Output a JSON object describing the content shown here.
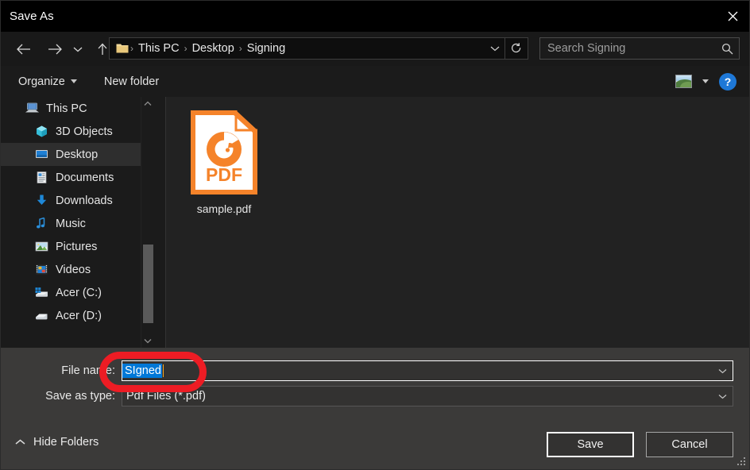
{
  "window": {
    "title": "Save As",
    "close_icon": "close-icon"
  },
  "nav": {
    "back_icon": "arrow-left-icon",
    "forward_icon": "arrow-right-icon",
    "history_icon": "chevron-down-icon",
    "up_icon": "arrow-up-icon",
    "address": {
      "folder_icon": "folder-icon",
      "separator": "›",
      "crumbs": [
        "This PC",
        "Desktop",
        "Signing"
      ],
      "dropdown_icon": "chevron-down-icon",
      "refresh_icon": "refresh-icon"
    },
    "search": {
      "placeholder": "Search Signing",
      "value": "",
      "icon": "search-icon"
    }
  },
  "command_bar": {
    "organize_label": "Organize",
    "new_folder_label": "New folder",
    "view_icon": "picture-view-icon",
    "view_dropdown_icon": "chevron-down-icon",
    "help_label": "?",
    "help_icon": "help-icon"
  },
  "sidebar": {
    "items": [
      {
        "label": "This PC",
        "icon": "this-pc-icon",
        "selected": false,
        "indent": false
      },
      {
        "label": "3D Objects",
        "icon": "3d-objects-icon",
        "selected": false,
        "indent": true
      },
      {
        "label": "Desktop",
        "icon": "desktop-icon",
        "selected": true,
        "indent": true
      },
      {
        "label": "Documents",
        "icon": "documents-icon",
        "selected": false,
        "indent": true
      },
      {
        "label": "Downloads",
        "icon": "downloads-icon",
        "selected": false,
        "indent": true
      },
      {
        "label": "Music",
        "icon": "music-icon",
        "selected": false,
        "indent": true
      },
      {
        "label": "Pictures",
        "icon": "pictures-icon",
        "selected": false,
        "indent": true
      },
      {
        "label": "Videos",
        "icon": "videos-icon",
        "selected": false,
        "indent": true
      },
      {
        "label": "Acer (C:)",
        "icon": "local-disk-c-icon",
        "selected": false,
        "indent": true
      },
      {
        "label": "Acer (D:)",
        "icon": "local-disk-d-icon",
        "selected": false,
        "indent": true
      }
    ],
    "scroll_up_icon": "chevron-up-icon",
    "scroll_down_icon": "chevron-down-icon"
  },
  "files": [
    {
      "name": "sample.pdf",
      "icon": "pdf-file-icon",
      "badge": "PDF"
    }
  ],
  "form": {
    "file_name_label": "File name:",
    "file_name_value": "SIgned",
    "file_name_dropdown_icon": "chevron-down-icon",
    "save_as_type_label": "Save as type:",
    "save_as_type_value": "Pdf Files (*.pdf)",
    "save_as_type_dropdown_icon": "chevron-down-icon"
  },
  "footer": {
    "hide_folders_label": "Hide Folders",
    "hide_folders_icon": "chevron-up-icon",
    "save_label": "Save",
    "cancel_label": "Cancel",
    "resize_grip_icon": "resize-grip-icon"
  },
  "colors": {
    "titlebar_bg": "#000000",
    "dialog_bg": "#1b1b1b",
    "filelist_bg": "#222222",
    "bottom_bg": "#3b3a39",
    "selection_blue": "#0078d7",
    "accent_orange": "#f5832a",
    "annotation_red": "#ed1c24",
    "help_blue": "#1e78d7"
  },
  "annotation": {
    "shape": "rounded-rectangle-highlight",
    "target": "file-name-input"
  }
}
